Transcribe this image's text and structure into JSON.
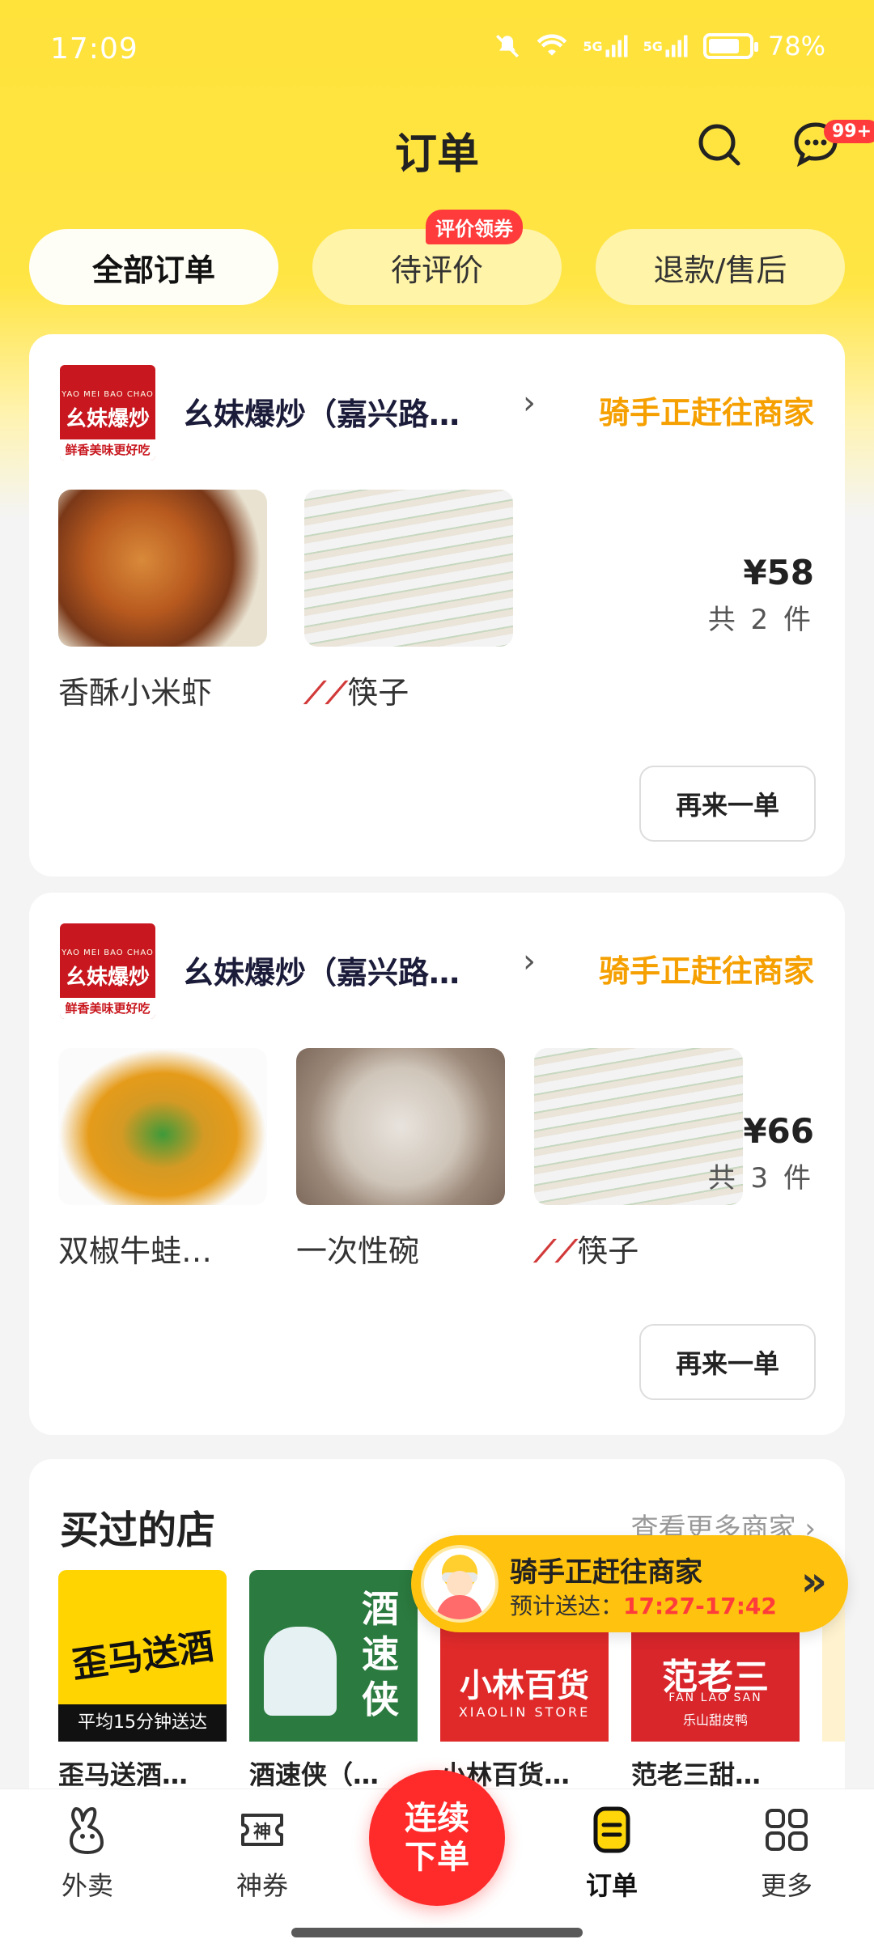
{
  "status_bar": {
    "time": "17:09",
    "network1": "5G",
    "network2": "5G",
    "battery": "78%",
    "battery_level": 0.78
  },
  "header": {
    "title": "订单",
    "message_badge": "99+"
  },
  "tabs": [
    {
      "label": "全部订单",
      "active": true
    },
    {
      "label": "待评价",
      "badge": "评价领券"
    },
    {
      "label": "退款/售后"
    }
  ],
  "orders": [
    {
      "shop_name": "幺妹爆炒（嘉兴路…",
      "status": "骑手正赶往商家",
      "logo": {
        "top": "YAO MEI BAO CHAO",
        "main": "幺妹爆炒",
        "slogan": "鲜香美味更好吃"
      },
      "items": [
        {
          "name": "香酥小米虾",
          "marks": ""
        },
        {
          "name": "筷子",
          "marks": "⟋⟋"
        }
      ],
      "price": "¥58",
      "count": "共 2 件",
      "reorder_label": "再来一单"
    },
    {
      "shop_name": "幺妹爆炒（嘉兴路…",
      "status": "骑手正赶往商家",
      "logo": {
        "top": "YAO MEI BAO CHAO",
        "main": "幺妹爆炒",
        "slogan": "鲜香美味更好吃"
      },
      "items": [
        {
          "name": "双椒牛蛙…",
          "marks": ""
        },
        {
          "name": "一次性碗",
          "marks": ""
        },
        {
          "name": "筷子",
          "marks": "⟋⟋"
        }
      ],
      "price": "¥66",
      "count": "共 3 件",
      "reorder_label": "再来一单"
    }
  ],
  "bought": {
    "title": "买过的店",
    "more_label": "查看更多商家 ›",
    "shops": [
      {
        "name": "歪马送酒…",
        "logo_text": "歪马送酒",
        "logo_sub": "平均15分钟送达"
      },
      {
        "name": "酒速侠（…",
        "logo_text": "酒速侠"
      },
      {
        "name": "小林百货…",
        "logo_text": "小林百货",
        "logo_sub": "XIAOLIN STORE"
      },
      {
        "name": "范老三甜…",
        "logo_text": "范老三",
        "logo_sub": "FAN LAO SAN",
        "logo_sub2": "乐山甜皮鸭"
      }
    ]
  },
  "rider_banner": {
    "title": "骑手正赶往商家",
    "eta_label": "预计送达：",
    "eta_time": "17:27-17:42"
  },
  "bottom_nav": [
    {
      "label": "外卖"
    },
    {
      "label": "神券"
    },
    {
      "label_line1": "连续",
      "label_line2": "下单"
    },
    {
      "label": "订单",
      "active": true
    },
    {
      "label": "更多"
    }
  ]
}
